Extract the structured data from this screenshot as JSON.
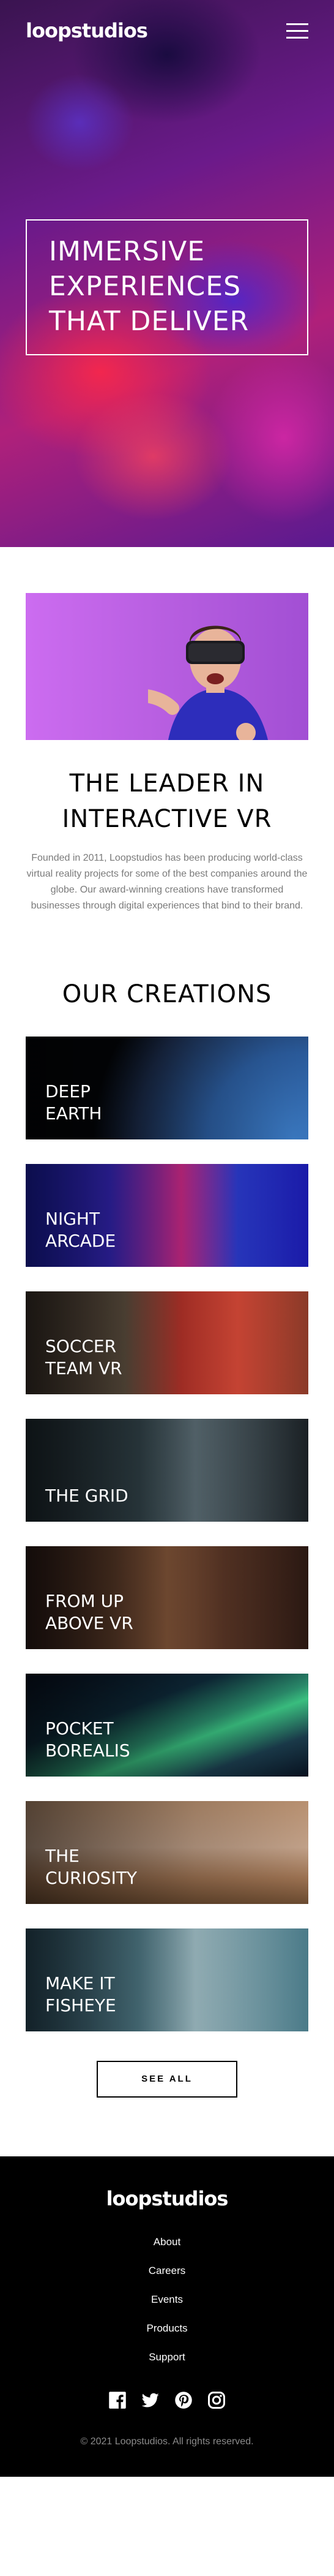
{
  "brand": {
    "logo_text": "loopstudios"
  },
  "nav": {
    "menu_icon": "hamburger-icon"
  },
  "hero": {
    "headline": "IMMERSIVE EXPERIENCES THAT DELIVER"
  },
  "interactive": {
    "title": "THE LEADER IN INTERACTIVE VR",
    "body": "Founded in 2011, Loopstudios has been producing world-class virtual reality projects for some of the best companies around the globe. Our award-winning creations have transformed businesses through digital experiences that bind to their brand."
  },
  "creations": {
    "title": "OUR CREATIONS",
    "items": [
      {
        "label": "DEEP\nEARTH"
      },
      {
        "label": "NIGHT\nARCADE"
      },
      {
        "label": "SOCCER\nTEAM VR"
      },
      {
        "label": "THE GRID"
      },
      {
        "label": "FROM UP\nABOVE VR"
      },
      {
        "label": "POCKET\nBOREALIS"
      },
      {
        "label": "THE\nCURIOSITY"
      },
      {
        "label": "MAKE IT\nFISHEYE"
      }
    ],
    "see_all_label": "SEE ALL"
  },
  "footer": {
    "logo_text": "loopstudios",
    "links": [
      "About",
      "Careers",
      "Events",
      "Products",
      "Support"
    ],
    "social_icons": [
      "facebook-icon",
      "twitter-icon",
      "pinterest-icon",
      "instagram-icon"
    ],
    "copyright": "© 2021 Loopstudios. All rights reserved."
  }
}
